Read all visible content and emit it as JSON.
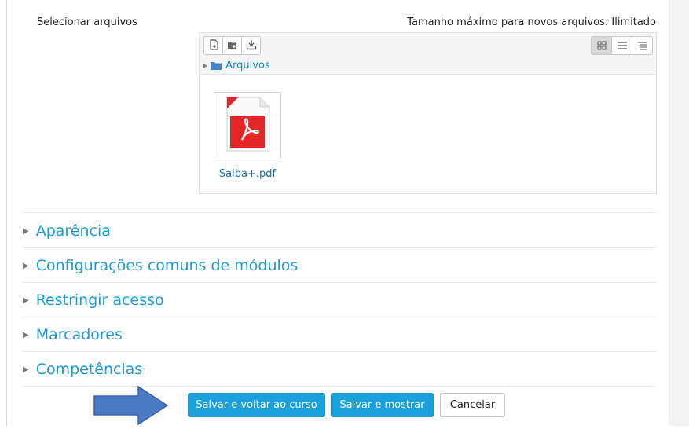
{
  "file_field": {
    "label": "Selecionar arquivos",
    "max_size_text": "Tamanho máximo para novos arquivos: Ilimitado"
  },
  "file_picker": {
    "toolbar_icons": [
      "add-file-icon",
      "create-folder-icon",
      "download-icon"
    ],
    "view_icons": [
      "grid-view-icon",
      "list-view-icon",
      "tree-view-icon"
    ],
    "active_view": "grid-view-icon",
    "breadcrumb_label": "Arquivos",
    "files": [
      {
        "name": "Saiba+.pdf",
        "icon": "pdf-icon"
      }
    ]
  },
  "sections": [
    {
      "label": "Aparência"
    },
    {
      "label": "Configurações comuns de módulos"
    },
    {
      "label": "Restringir acesso"
    },
    {
      "label": "Marcadores"
    },
    {
      "label": "Competências"
    }
  ],
  "actions": {
    "save_return": "Salvar e voltar ao curso",
    "save_display": "Salvar e mostrar",
    "cancel": "Cancelar"
  },
  "colors": {
    "link": "#1a9bd1",
    "primary_button": "#1aa0db",
    "annotation_arrow": "#4a78c2"
  }
}
